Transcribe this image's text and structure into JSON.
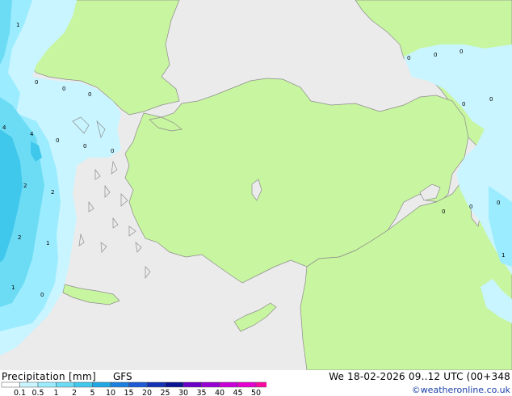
{
  "legend": {
    "title": "Precipitation [mm]",
    "model": "GFS",
    "ticks": [
      "0.1",
      "0.5",
      "1",
      "2",
      "5",
      "10",
      "15",
      "20",
      "25",
      "30",
      "35",
      "40",
      "45",
      "50"
    ],
    "colors": [
      "#ffffff",
      "#c8f5ff",
      "#9cecff",
      "#6cdcf5",
      "#40c8ec",
      "#20a8e4",
      "#1e80dc",
      "#1e5ad4",
      "#1432b4",
      "#0a1490",
      "#6a00c8",
      "#9600d2",
      "#c800d8",
      "#e600d0",
      "#fa0aa0"
    ]
  },
  "header": {
    "datetime": "We 18-02-2026 09..12 UTC (00+348",
    "credit": "©weatheronline.co.uk"
  },
  "map": {
    "colors": {
      "sea": "#ebebeb",
      "land": "#c8f5a0",
      "coast": "#8c8c8c",
      "precip_light": "#c8f5ff",
      "precip_mid": "#9cecff",
      "precip_heavy": "#6cdcf5",
      "precip_max": "#40c8ec"
    },
    "values": [
      "1",
      "0",
      "0",
      "0",
      "4",
      "4",
      "2",
      "2",
      "2",
      "1",
      "1",
      "0",
      "0",
      "0",
      "0",
      "0",
      "0",
      "0",
      "0",
      "0",
      "0",
      "0",
      "1",
      "0"
    ]
  }
}
